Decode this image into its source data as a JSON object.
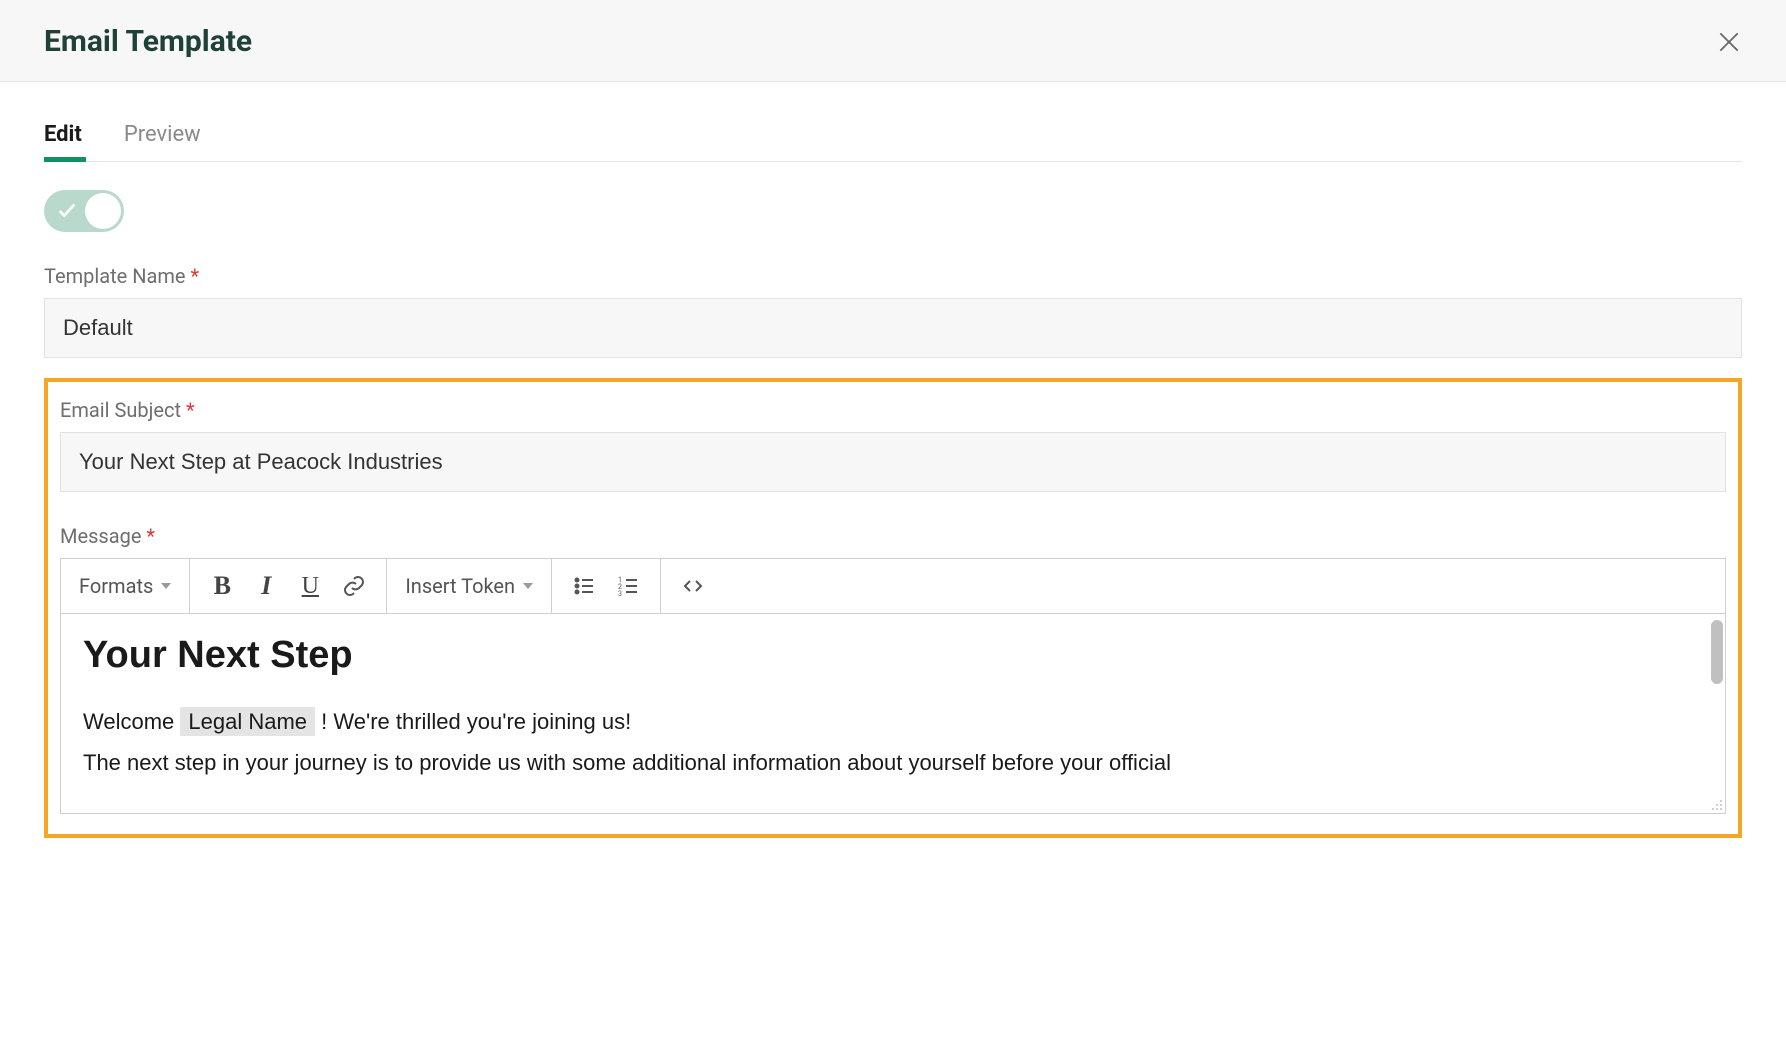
{
  "header": {
    "title": "Email Template"
  },
  "tabs": {
    "edit": "Edit",
    "preview": "Preview"
  },
  "toggle": {
    "on": true
  },
  "fields": {
    "template_name_label": "Template Name",
    "template_name_value": "Default",
    "email_subject_label": "Email Subject",
    "email_subject_value": "Your Next Step at Peacock Industries",
    "message_label": "Message"
  },
  "toolbar": {
    "formats": "Formats",
    "insert_token": "Insert Token"
  },
  "editor": {
    "heading": "Your Next Step",
    "line1_prefix": "Welcome ",
    "line1_token": "Legal Name",
    "line1_suffix": " ! We're thrilled you're joining us!",
    "line2": "The next step in your journey is to provide us with some additional information about yourself before your official"
  },
  "icons": {
    "close": "close-icon",
    "check": "check-icon",
    "bold": "bold-icon",
    "italic": "italic-icon",
    "underline": "underline-icon",
    "link": "link-icon",
    "ul": "bullet-list-icon",
    "ol": "numbered-list-icon",
    "code": "code-icon"
  }
}
